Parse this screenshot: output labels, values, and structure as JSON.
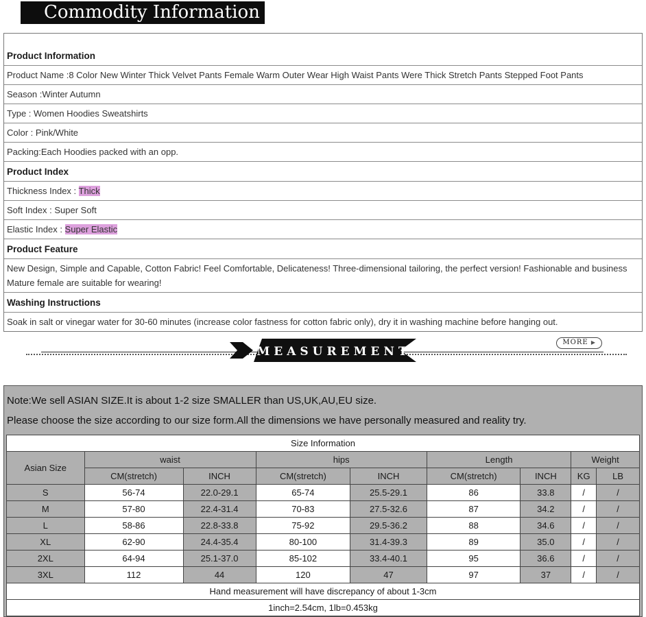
{
  "colors": {
    "banner_black": "#0d0d0d",
    "highlight_plum": "#dda0dd",
    "section_gray": "#b0b0b0",
    "accent_red": "#ff0000"
  },
  "page_title": "Commodity Information",
  "product_table": {
    "rows": [
      {
        "type": "section",
        "first": true,
        "segments": [
          {
            "text": "Product Information"
          }
        ]
      },
      {
        "type": "field",
        "segments": [
          {
            "text": "Product Name :8 Color New Winter Thick Velvet Pants Female Warm Outer Wear High Waist Pants Were Thick Stretch Pants Stepped Foot Pants"
          }
        ]
      },
      {
        "type": "field",
        "segments": [
          {
            "text": "Season :Winter Autumn"
          }
        ]
      },
      {
        "type": "field",
        "segments": [
          {
            "text": "Type : Women Hoodies Sweatshirts"
          }
        ]
      },
      {
        "type": "field",
        "segments": [
          {
            "text": "Color : Pink/White"
          }
        ]
      },
      {
        "type": "field",
        "segments": [
          {
            "text": "Packing:Each Hoodies packed with an opp."
          }
        ]
      },
      {
        "type": "section",
        "segments": [
          {
            "text": "Product Index"
          }
        ]
      },
      {
        "type": "field",
        "segments": [
          {
            "text": "Thickness Index :    "
          },
          {
            "text": "Thick",
            "highlight": true
          }
        ]
      },
      {
        "type": "field",
        "segments": [
          {
            "text": "Soft Index :  Super Soft"
          }
        ]
      },
      {
        "type": "field",
        "segments": [
          {
            "text": "Elastic Index :  "
          },
          {
            "text": "Super Elastic",
            "highlight": true
          }
        ]
      },
      {
        "type": "section",
        "segments": [
          {
            "text": "Product Feature"
          }
        ]
      },
      {
        "type": "field",
        "segments": [
          {
            "text": "New Design, Simple and Capable, Cotton Fabric! Feel Comfortable, Delicateness! Three-dimensional tailoring, the perfect version! Fashionable and business Mature female are suitable for wearing!"
          }
        ]
      },
      {
        "type": "section",
        "segments": [
          {
            "text": "Washing Instructions"
          }
        ]
      },
      {
        "type": "field",
        "segments": [
          {
            "text": "Soak in salt or vinegar water for 30-60 minutes (increase color fastness for cotton fabric only), dry it in washing machine before hanging out."
          }
        ]
      }
    ]
  },
  "more_button": {
    "label": "MORE",
    "arrow": "▶"
  },
  "measurement_banner": {
    "label": "MEASUREMENT"
  },
  "size_section": {
    "note1": "Note:We sell ASIAN SIZE.It is about 1-2 size SMALLER than US,UK,AU,EU size.",
    "note2": "Please choose the size according to our size form.All the dimensions we have personally measured and reality try.",
    "table_title": "Size Information",
    "col_group_labels": {
      "size": "Asian Size",
      "waist": "waist",
      "hips": "hips",
      "length": "Length",
      "weight": "Weight"
    },
    "sub_headers": [
      "CM(stretch)",
      "INCH",
      "CM(stretch)",
      "INCH",
      "CM(stretch)",
      "INCH",
      "KG",
      "LB"
    ],
    "rows": [
      {
        "size": "S",
        "cells": [
          "56-74",
          "22.0-29.1",
          "65-74",
          "25.5-29.1",
          "86",
          "33.8",
          "/",
          "/"
        ]
      },
      {
        "size": "M",
        "cells": [
          "57-80",
          "22.4-31.4",
          "70-83",
          "27.5-32.6",
          "87",
          "34.2",
          "/",
          "/"
        ]
      },
      {
        "size": "L",
        "cells": [
          "58-86",
          "22.8-33.8",
          "75-92",
          "29.5-36.2",
          "88",
          "34.6",
          "/",
          "/"
        ]
      },
      {
        "size": "XL",
        "cells": [
          "62-90",
          "24.4-35.4",
          "80-100",
          "31.4-39.3",
          "89",
          "35.0",
          "/",
          "/"
        ]
      },
      {
        "size": "2XL",
        "cells": [
          "64-94",
          "25.1-37.0",
          "85-102",
          "33.4-40.1",
          "95",
          "36.6",
          "/",
          "/"
        ]
      },
      {
        "size": "3XL",
        "cells": [
          "112",
          "44",
          "120",
          "47",
          "97",
          "37",
          "/",
          "/"
        ]
      }
    ],
    "footnote1": "Hand measurement will have discrepancy of about 1-3cm",
    "footnote2": "1inch=2.54cm, 1lb=0.453kg"
  }
}
